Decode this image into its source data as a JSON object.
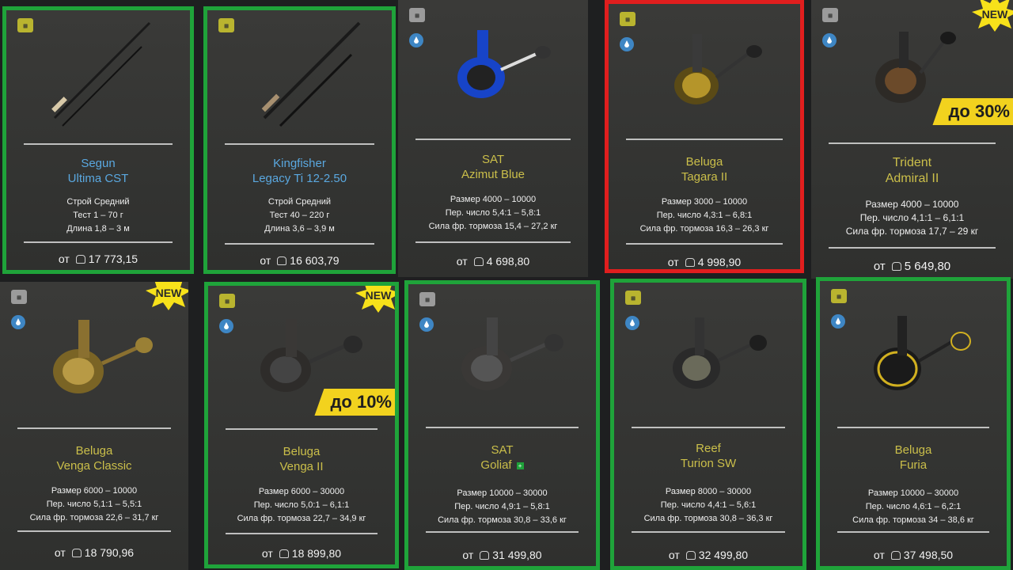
{
  "cards": [
    {
      "brand": "Segun",
      "model": "Ultima CST",
      "kind": "rod",
      "specs": [
        "Строй Средний",
        "Тест 1 – 70 г",
        "Длина 1,8 – 3 м"
      ],
      "from": "от",
      "price": "17 773,15",
      "level_icon": "level-yellow-icon",
      "highlight": "green"
    },
    {
      "brand": "Kingfisher",
      "model": "Legacy Ti 12-2.50",
      "kind": "rod",
      "specs": [
        "Строй Средний",
        "Тест 40 – 220 г",
        "Длина 3,6 – 3,9 м"
      ],
      "from": "от",
      "price": "16 603,79",
      "level_icon": "level-yellow-icon",
      "highlight": "green"
    },
    {
      "brand": "SAT",
      "model": "Azimut Blue",
      "kind": "reel",
      "specs": [
        "Размер 4000 – 10000",
        "Пер. число 5,4:1 – 5,8:1",
        "Сила фр. тормоза 15,4 – 27,2 кг"
      ],
      "from": "от",
      "price": "4 698,80",
      "level_icon": "level-grey-icon",
      "highlight": "none"
    },
    {
      "brand": "Beluga",
      "model": "Tagara II",
      "kind": "reel",
      "specs": [
        "Размер 3000 – 10000",
        "Пер. число 4,3:1 – 6,8:1",
        "Сила фр. тормоза 16,3 – 26,3 кг"
      ],
      "from": "от",
      "price": "4 998,90",
      "level_icon": "level-yellow-icon",
      "highlight": "red"
    },
    {
      "brand": "Trident",
      "model": "Admiral II",
      "kind": "reel",
      "specs": [
        "Размер 4000 – 10000",
        "Пер. число 4,1:1 – 6,1:1",
        "Сила фр. тормоза 17,7 – 29 кг"
      ],
      "from": "от",
      "price": "5 649,80",
      "level_icon": "level-grey-icon",
      "highlight": "none",
      "badge": "NEW",
      "discount": "до 30%"
    },
    {
      "brand": "Beluga",
      "model": "Venga Classic",
      "kind": "reel",
      "specs": [
        "Размер 6000 – 10000",
        "Пер. число 5,1:1 – 5,5:1",
        "Сила фр. тормоза 22,6 – 31,7 кг"
      ],
      "from": "от",
      "price": "18 790,96",
      "level_icon": "level-grey-icon",
      "highlight": "none",
      "badge": "NEW"
    },
    {
      "brand": "Beluga",
      "model": "Venga II",
      "kind": "reel",
      "specs": [
        "Размер 6000 – 30000",
        "Пер. число 5,0:1 – 6,1:1",
        "Сила фр. тормоза 22,7 – 34,9 кг"
      ],
      "from": "от",
      "price": "18 899,80",
      "level_icon": "level-yellow-icon",
      "highlight": "green",
      "badge": "NEW",
      "discount": "до 10%"
    },
    {
      "brand": "SAT",
      "model": "Goliaf",
      "kind": "reel",
      "specs": [
        "Размер 10000 – 30000",
        "Пер. число 4,9:1 – 5,8:1",
        "Сила фр. тормоза 30,8 – 33,6 кг"
      ],
      "from": "от",
      "price": "31 499,80",
      "level_icon": "level-grey-icon",
      "highlight": "green"
    },
    {
      "brand": "Reef",
      "model": "Turion SW",
      "kind": "reel",
      "specs": [
        "Размер 8000 – 30000",
        "Пер. число 4,4:1 – 5,6:1",
        "Сила фр. тормоза 30,8 – 36,3 кг"
      ],
      "from": "от",
      "price": "32 499,80",
      "level_icon": "level-yellow-icon",
      "highlight": "green"
    },
    {
      "brand": "Beluga",
      "model": "Furia",
      "kind": "reel",
      "specs": [
        "Размер 10000 – 30000",
        "Пер. число 4,6:1 – 6,2:1",
        "Сила фр. тормоза 34 – 38,6 кг"
      ],
      "from": "от",
      "price": "37 498,50",
      "level_icon": "level-yellow-icon",
      "highlight": "green"
    }
  ],
  "colors": {
    "highlight_green": "#1fa33a",
    "highlight_red": "#e01e1e",
    "rod_name": "#5aa8e0",
    "reel_name": "#cbbf4a",
    "discount_bg": "#f2d21e",
    "badge_bg": "#f7e11a"
  }
}
